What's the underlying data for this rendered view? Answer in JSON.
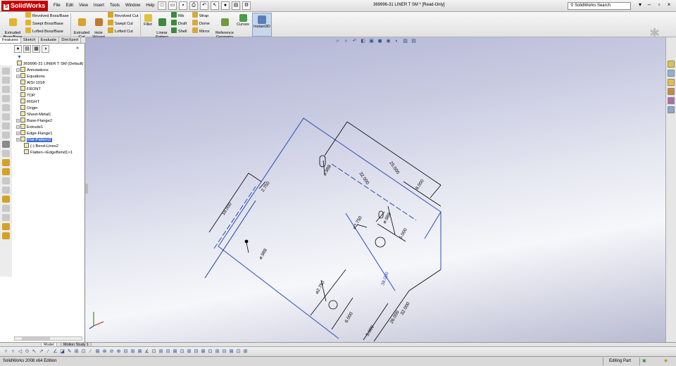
{
  "app": {
    "brand": "SolidWorks",
    "document_title": "369996-31 LINER T SM * [Read-Only]",
    "search_placeholder": "SolidWorks Search"
  },
  "menus": [
    "File",
    "Edit",
    "View",
    "Insert",
    "Tools",
    "Window",
    "Help"
  ],
  "command_manager": {
    "extruded_boss": "Extruded\nBoss/Base",
    "revolved_boss": "Revolved Boss/Base",
    "swept_boss": "Swept Boss/Base",
    "lofted_boss": "Lofted Boss/Base",
    "extruded_cut": "Extruded\nCut",
    "hole_wizard": "Hole\nWizard",
    "revolved_cut": "Revolved Cut",
    "swept_cut": "Swept Cut",
    "lofted_cut": "Lofted Cut",
    "fillet": "Fillet",
    "linear_pattern": "Linear\nPattern",
    "rib": "Rib",
    "draft": "Draft",
    "shell": "Shell",
    "wrap": "Wrap",
    "dome": "Dome",
    "mirror": "Mirror",
    "reference_geometry": "Reference\nGeometry",
    "curves": "Curves",
    "instant3d": "Instant3D"
  },
  "panel_tabs": [
    "Features",
    "Sketch",
    "Evaluate",
    "DimXpert"
  ],
  "feature_tree": [
    {
      "label": "369996-31 LINER T SM  (Default)",
      "indent": 0,
      "expander": false,
      "selected": false
    },
    {
      "label": "Annotations",
      "indent": 1,
      "expander": true,
      "selected": false
    },
    {
      "label": "Equations",
      "indent": 1,
      "expander": true,
      "selected": false
    },
    {
      "label": "AISI 1018",
      "indent": 1,
      "expander": false,
      "selected": false
    },
    {
      "label": "FRONT",
      "indent": 1,
      "expander": false,
      "selected": false
    },
    {
      "label": "TOP",
      "indent": 1,
      "expander": false,
      "selected": false
    },
    {
      "label": "RIGHT",
      "indent": 1,
      "expander": false,
      "selected": false
    },
    {
      "label": "Origin",
      "indent": 1,
      "expander": false,
      "selected": false
    },
    {
      "label": "Sheet-Metal1",
      "indent": 1,
      "expander": false,
      "selected": false
    },
    {
      "label": "Base-Flange2",
      "indent": 1,
      "expander": true,
      "selected": false
    },
    {
      "label": "Extrude1",
      "indent": 1,
      "expander": true,
      "selected": false
    },
    {
      "label": "Edge-Flange1",
      "indent": 1,
      "expander": true,
      "selected": false
    },
    {
      "label": "Flat-Pattern2",
      "indent": 1,
      "expander": true,
      "selected": true
    },
    {
      "label": "(-) Bend-Lines2",
      "indent": 2,
      "expander": false,
      "selected": false
    },
    {
      "label": "Flatten-<EdgeBend1>1",
      "indent": 2,
      "expander": false,
      "selected": false
    }
  ],
  "dimensions": {
    "d_25": "25.000",
    "d_32a": "32.000",
    "d_8": "8.000",
    "d_18": "18.000",
    "d_2750a": "2.750",
    "d_phi988a": "⌀.988",
    "d_phi988b": "⌀.988",
    "d_phi988c": "⌀.988",
    "d_phi2750a": "⌀2.750",
    "d_phi2750b": "⌀2.750",
    "d_5a": "5.000",
    "d_38": "38.000",
    "d_26": "26.000",
    "d_32b": "32.000",
    "d_5b": "5.000",
    "d_6": "6.000"
  },
  "bottom_tabs": [
    "Model",
    "Motion Study 1"
  ],
  "status": {
    "left": "SolidWorks 2008 x64 Edition",
    "mode": "Editing Part"
  }
}
